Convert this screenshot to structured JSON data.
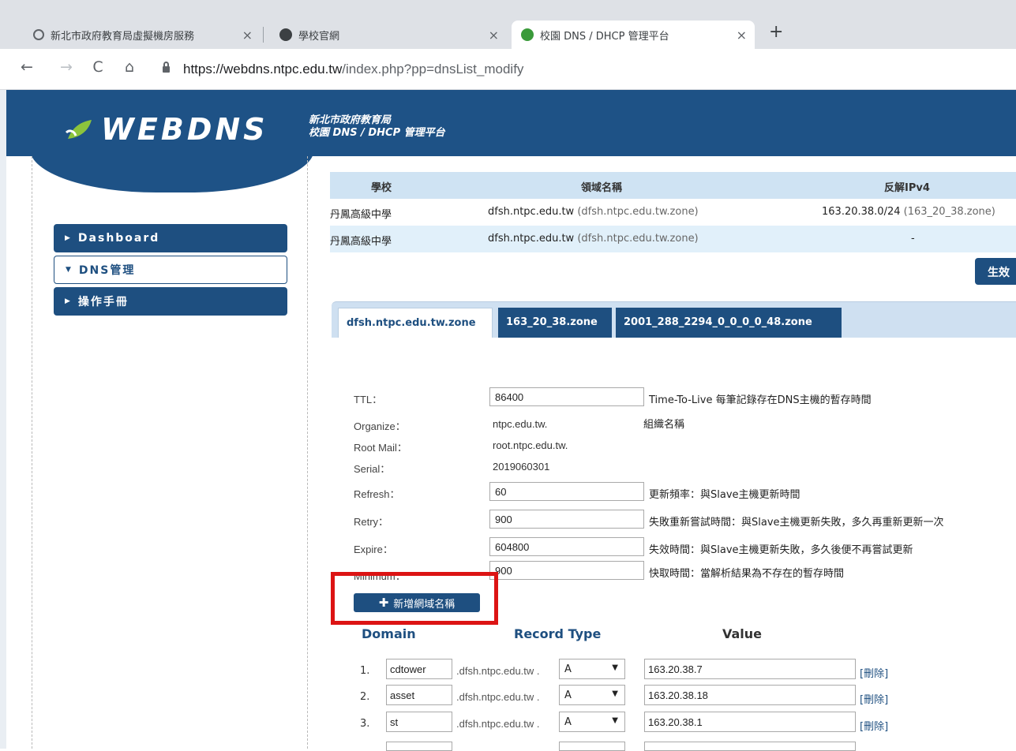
{
  "browser": {
    "tabs": [
      {
        "title": "新北市政府教育局虛擬機房服務",
        "active": false
      },
      {
        "title": "學校官網",
        "active": false
      },
      {
        "title": "校園 DNS / DHCP 管理平台",
        "active": true
      }
    ],
    "close_glyph": "×",
    "new_tab_glyph": "+",
    "url_host": "https://webdns.ntpc.edu.tw",
    "url_rest": "/index.php?pp=dnsList_modify",
    "nav": {
      "back": "←",
      "forward": "→",
      "reload": "C",
      "home": "⌂"
    }
  },
  "header": {
    "logo": "WEBDNS",
    "org_line1": "新北市政府教育局",
    "org_line2": "校園 DNS / DHCP 管理平台"
  },
  "sidebar": {
    "items": [
      {
        "label": "Dashboard",
        "expanded": false
      },
      {
        "label": "DNS管理",
        "expanded": true
      },
      {
        "label": "操作手冊",
        "expanded": false
      }
    ]
  },
  "zone_table": {
    "headers": [
      "學校",
      "領域名稱",
      "反解IPv4"
    ],
    "rows": [
      {
        "school": "丹鳳高級中學",
        "domain": "dfsh.ntpc.edu.tw",
        "zone": "(dfsh.ntpc.edu.tw.zone)",
        "reverse": "163.20.38.0/24",
        "reverse_zone": "(163_20_38.zone)"
      },
      {
        "school": "丹鳳高級中學",
        "domain": "dfsh.ntpc.edu.tw",
        "zone": "(dfsh.ntpc.edu.tw.zone)",
        "reverse": "-",
        "reverse_zone": ""
      }
    ]
  },
  "apply_button": "生效",
  "zone_tabs": [
    "dfsh.ntpc.edu.tw.zone",
    "163_20_38.zone",
    "2001_288_2294_0_0_0_0_48.zone"
  ],
  "soa": {
    "ttl": {
      "label": "TTL：",
      "value": "86400",
      "desc": "Time-To-Live 每筆記錄存在DNS主機的暫存時間"
    },
    "organize": {
      "label": "Organize：",
      "value": "ntpc.edu.tw.",
      "desc": "組織名稱"
    },
    "root_mail": {
      "label": "Root Mail：",
      "value": "root.ntpc.edu.tw."
    },
    "serial": {
      "label": "Serial：",
      "value": "2019060301"
    },
    "refresh": {
      "label": "Refresh：",
      "value": "60",
      "desc": "更新頻率：與Slave主機更新時間"
    },
    "retry": {
      "label": "Retry：",
      "value": "900",
      "desc": "失敗重新嘗試時間：與Slave主機更新失敗，多久再重新更新一次"
    },
    "expire": {
      "label": "Expire：",
      "value": "604800",
      "desc": "失效時間：與Slave主機更新失敗，多久後便不再嘗試更新"
    },
    "minimum": {
      "label": "Minimum：",
      "value": "900",
      "desc": "快取時間：當解析結果為不存在的暫存時間"
    }
  },
  "add_domain_button": "新增網域名稱",
  "records": {
    "headers": {
      "domain": "Domain",
      "type": "Record Type",
      "value": "Value"
    },
    "suffix": ".dfsh.ntpc.edu.tw .",
    "delete_label": "[刪除]",
    "rows": [
      {
        "num": "1.",
        "domain": "cdtower",
        "type": "A",
        "value": "163.20.38.7"
      },
      {
        "num": "2.",
        "domain": "asset",
        "type": "A",
        "value": "163.20.38.18"
      },
      {
        "num": "3.",
        "domain": "st",
        "type": "A",
        "value": "163.20.38.1"
      }
    ]
  },
  "colors": {
    "primary": "#1e4f80",
    "highlight": "#dc1414",
    "table_head": "#cfe3f3"
  }
}
